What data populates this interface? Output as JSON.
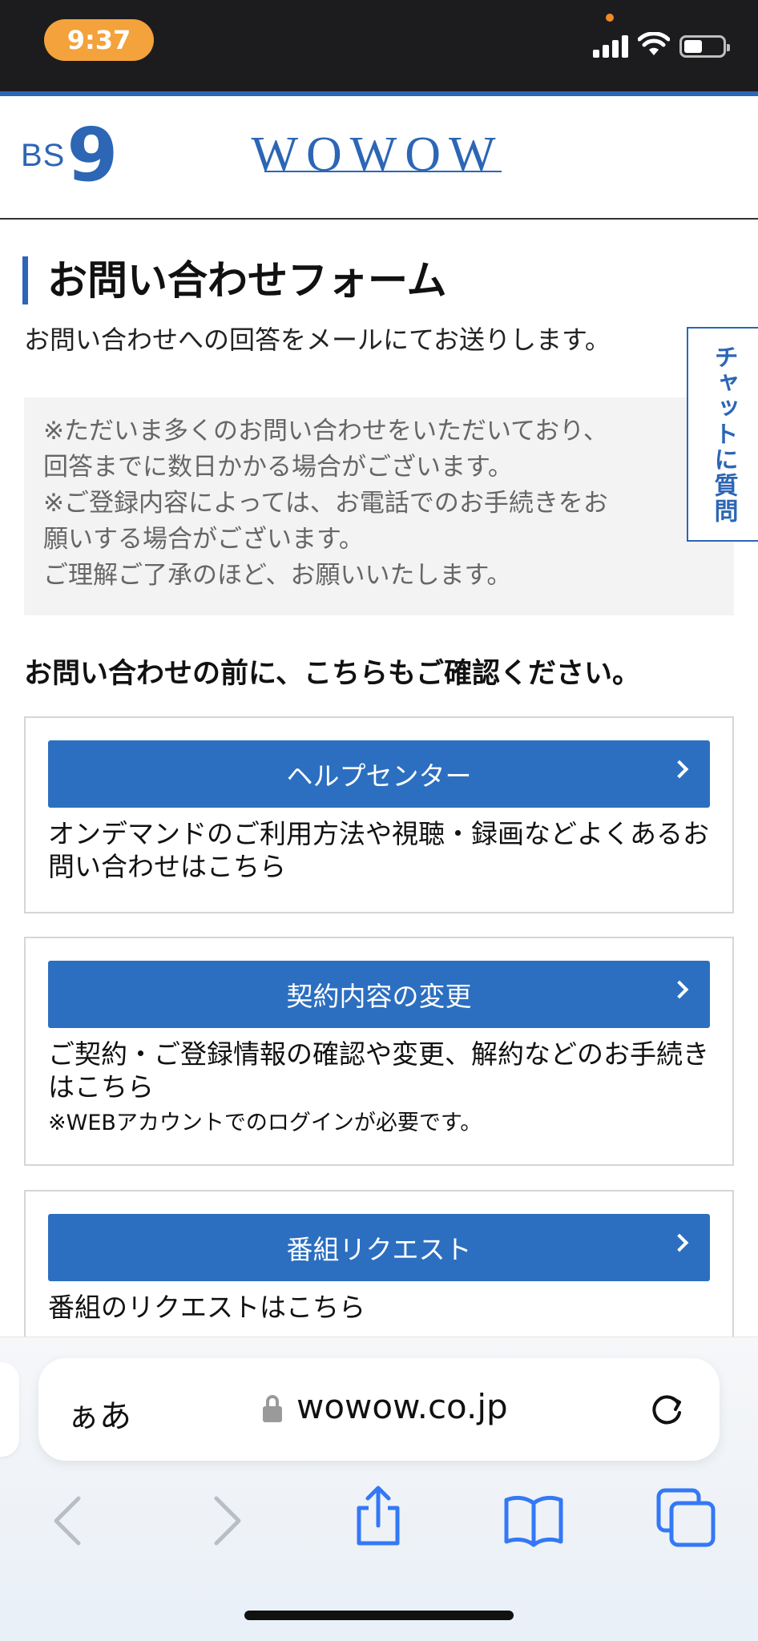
{
  "status_bar": {
    "time": "9:37"
  },
  "header": {
    "bs_text": "BS",
    "bs_number": "9",
    "brand": "WOWOW"
  },
  "main": {
    "title": "お問い合わせフォーム",
    "subtitle": "お問い合わせへの回答をメールにてお送りします。",
    "notice_lines": [
      "※ただいま多くのお問い合わせをいただいており、",
      "回答までに数日かかる場合がございます。",
      "※ご登録内容によっては、お電話でのお手続きをお",
      "願いする場合がございます。",
      "ご理解ご了承のほど、お願いいたします。"
    ],
    "confirm_heading": "お問い合わせの前に、こちらもご確認ください。",
    "cards": [
      {
        "button_label": "ヘルプセンター",
        "description": "オンデマンドのご利用方法や視聴・録画などよくあるお問い合わせはこちら"
      },
      {
        "button_label": "契約内容の変更",
        "description": "ご契約・ご登録情報の確認や変更、解約などのお手続きはこちら",
        "note": "※WEBアカウントでのログインが必要です。"
      },
      {
        "button_label": "番組リクエスト",
        "description": "番組のリクエストはこちら"
      }
    ]
  },
  "chat_tab": {
    "label": "チャットに質問"
  },
  "browser": {
    "aa_label": "ぁあ",
    "domain": "wowow.co.jp"
  },
  "icons": {
    "accent": "#2c66b5",
    "button_bg": "#2c6fc0",
    "toolbar_blue": "#3478f6"
  }
}
